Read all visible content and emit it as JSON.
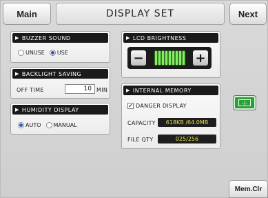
{
  "header": {
    "main_label": "Main",
    "title": "DISPLAY SET",
    "next_label": "Next"
  },
  "buzzer": {
    "title": "BUZZER SOUND",
    "options": [
      "UNUSE",
      "USE"
    ],
    "selected": "USE"
  },
  "backlight": {
    "title": "BACKLIGHT SAVING",
    "off_time_label": "OFF TIME",
    "off_time_value": "10",
    "unit": "MIN"
  },
  "humidity": {
    "title": "HUMIDITY DISPLAY",
    "options": [
      "AUTO",
      "MANUAL"
    ],
    "selected": "AUTO"
  },
  "lcd": {
    "title": "LCD BRIGHTNESS",
    "minus": "−",
    "plus": "+",
    "level_bars": 9
  },
  "memory": {
    "title": "INTERNAL MEMORY",
    "danger_label": "DANGER DISPLAY",
    "danger_checked": true,
    "capacity_label": "CAPACITY",
    "capacity_value": "618KB /64.0MB",
    "file_label": "FILE QTY",
    "file_value": "025/256"
  },
  "side": {
    "green_button_glyph": "-|-",
    "memclr_label": "Mem.Clr"
  },
  "colors": {
    "lcd_green": "#7df25a",
    "value_yellow": "#e8e05a",
    "radio_blue": "#2a56c8",
    "green_button": "#2d9d3c"
  }
}
